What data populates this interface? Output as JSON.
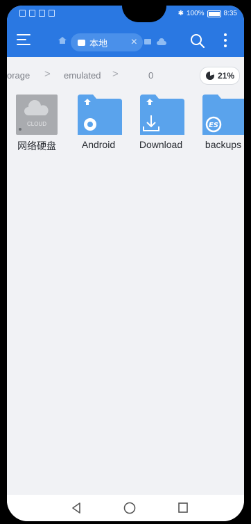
{
  "status_bar": {
    "battery": "100%",
    "time": "8:35"
  },
  "toolbar": {
    "tab_label": "本地",
    "tab_close": "×"
  },
  "breadcrumb": {
    "segments": [
      "orage",
      "emulated",
      "0"
    ],
    "separator": ">",
    "storage_usage": "21%"
  },
  "files": [
    {
      "name": "网络硬盘",
      "icon": "cloud-drive-icon",
      "badge": "CLOUD"
    },
    {
      "name": "Android",
      "icon": "android-folder-icon"
    },
    {
      "name": "Download",
      "icon": "download-folder-icon"
    },
    {
      "name": "backups",
      "icon": "backup-folder-icon"
    }
  ],
  "colors": {
    "accent": "#2a78e2",
    "folder": "#5aa3ec",
    "background": "#f1f2f5"
  }
}
